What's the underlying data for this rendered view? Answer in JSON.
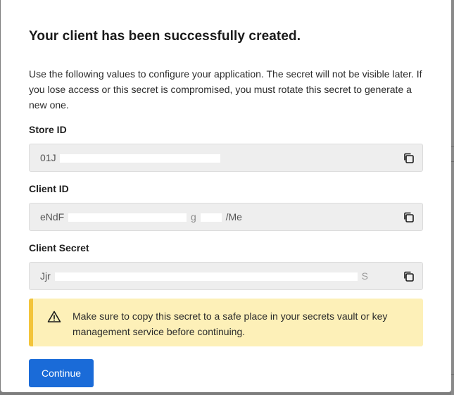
{
  "modal": {
    "title": "Your client has been successfully created.",
    "description": "Use the following values to configure your application. The secret will not be visible later. If you lose access or this secret is compromised, you must rotate this secret to generate a new one."
  },
  "fields": [
    {
      "label": "Store ID",
      "value_start": "01J",
      "value_end": "",
      "icon": "copy-icon"
    },
    {
      "label": "Client ID",
      "value_start": "eNdF",
      "value_end": "/Me",
      "icon": "copy-icon"
    },
    {
      "label": "Client Secret",
      "value_start": "Jjr",
      "value_end": "S",
      "icon": "copy-icon"
    }
  ],
  "warning": {
    "icon": "warning-triangle-icon",
    "text": "Make sure to copy this secret to a safe place in your secrets vault or key management service before continuing."
  },
  "actions": {
    "continue_label": "Continue"
  },
  "colors": {
    "primary": "#1a6bd8",
    "warning_bg": "#fdf0b8",
    "warning_accent": "#f3c43a",
    "field_bg": "#eeeeee"
  }
}
